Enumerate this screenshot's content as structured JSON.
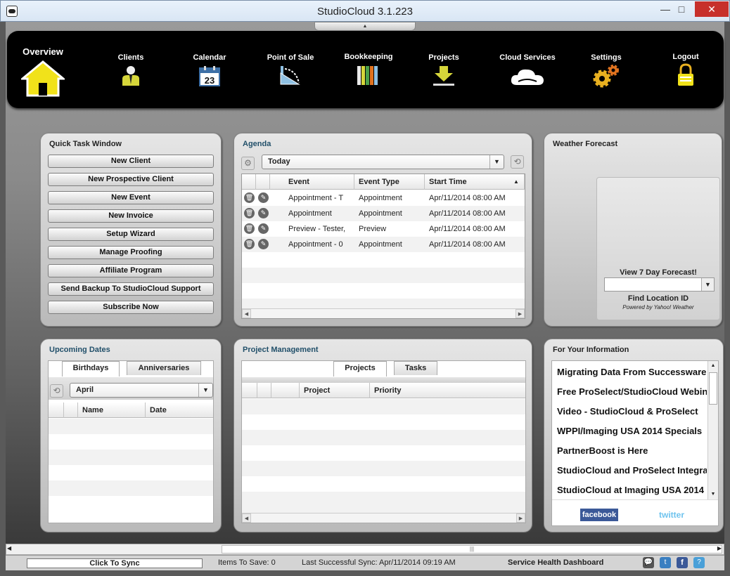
{
  "window": {
    "title": "StudioCloud 3.1.223",
    "min": "—",
    "max": "□",
    "close": "✕"
  },
  "nav": [
    {
      "label": "Overview",
      "icon": "home-icon"
    },
    {
      "label": "Clients",
      "icon": "client-icon"
    },
    {
      "label": "Calendar",
      "icon": "calendar-icon",
      "day": "23"
    },
    {
      "label": "Point of Sale",
      "icon": "point-of-sale-icon"
    },
    {
      "label": "Bookkeeping",
      "icon": "books-icon"
    },
    {
      "label": "Projects",
      "icon": "download-tray-icon"
    },
    {
      "label": "Cloud Services",
      "icon": "cloud-icon"
    },
    {
      "label": "Settings",
      "icon": "gears-icon"
    },
    {
      "label": "Logout",
      "icon": "padlock-icon"
    }
  ],
  "quick": {
    "title": "Quick Task Window",
    "buttons": [
      "New Client",
      "New Prospective Client",
      "New Event",
      "New Invoice",
      "Setup Wizard",
      "Manage Proofing",
      "Affiliate Program",
      "Send Backup To StudioCloud Support",
      "Subscribe Now"
    ]
  },
  "agenda": {
    "title": "Agenda",
    "filter": "Today",
    "columns": [
      "Event",
      "Event Type",
      "Start Time"
    ],
    "sort_glyph": "▲",
    "rows": [
      {
        "event": "Appointment - T",
        "type": "Appointment",
        "start": "Apr/11/2014 08:00 AM"
      },
      {
        "event": "Appointment",
        "type": "Appointment",
        "start": "Apr/11/2014 08:00 AM"
      },
      {
        "event": "Preview - Tester,",
        "type": "Preview",
        "start": "Apr/11/2014 08:00 AM"
      },
      {
        "event": "Appointment - 0",
        "type": "Appointment",
        "start": "Apr/11/2014 08:00 AM"
      }
    ]
  },
  "weather": {
    "title": "Weather Forecast",
    "forecast_link": "View 7 Day Forecast!",
    "find_location": "Find Location ID",
    "powered": "Powered by Yahoo! Weather"
  },
  "upcoming": {
    "title": "Upcoming Dates",
    "tabs": [
      "Birthdays",
      "Anniversaries"
    ],
    "month": "April",
    "columns": [
      "Name",
      "Date"
    ]
  },
  "projects": {
    "title": "Project Management",
    "tabs": [
      "Projects",
      "Tasks"
    ],
    "columns": [
      "Project",
      "Priority"
    ]
  },
  "info": {
    "title": "For Your Information",
    "items": [
      "Migrating Data From Successware",
      "Free ProSelect/StudioCloud Webinar",
      "Video - StudioCloud & ProSelect",
      "WPPI/Imaging USA 2014 Specials",
      "PartnerBoost is Here",
      "StudioCloud and ProSelect Integration",
      "StudioCloud at Imaging USA 2014"
    ],
    "facebook": "facebook",
    "twitter": "twitter"
  },
  "status": {
    "sync": "Click To Sync",
    "items_to_save": "Items To Save: 0",
    "last_sync": "Last Successful Sync: Apr/11/2014 09:19 AM",
    "health": "Service Health Dashboard"
  }
}
